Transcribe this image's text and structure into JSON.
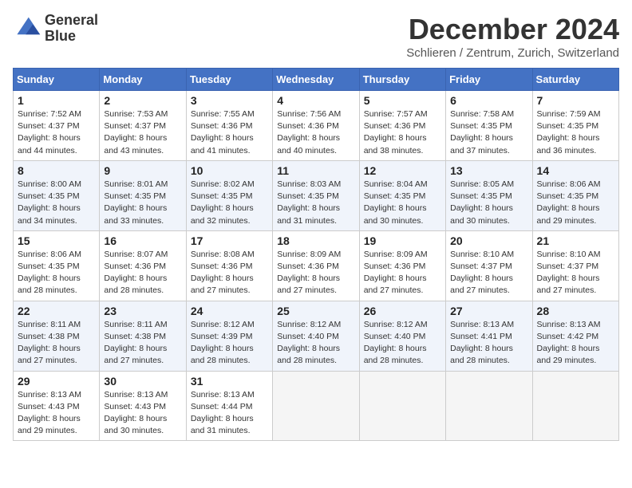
{
  "header": {
    "logo_line1": "General",
    "logo_line2": "Blue",
    "month_title": "December 2024",
    "subtitle": "Schlieren / Zentrum, Zurich, Switzerland"
  },
  "days_of_week": [
    "Sunday",
    "Monday",
    "Tuesday",
    "Wednesday",
    "Thursday",
    "Friday",
    "Saturday"
  ],
  "weeks": [
    [
      {
        "day": "1",
        "info": "Sunrise: 7:52 AM\nSunset: 4:37 PM\nDaylight: 8 hours\nand 44 minutes."
      },
      {
        "day": "2",
        "info": "Sunrise: 7:53 AM\nSunset: 4:37 PM\nDaylight: 8 hours\nand 43 minutes."
      },
      {
        "day": "3",
        "info": "Sunrise: 7:55 AM\nSunset: 4:36 PM\nDaylight: 8 hours\nand 41 minutes."
      },
      {
        "day": "4",
        "info": "Sunrise: 7:56 AM\nSunset: 4:36 PM\nDaylight: 8 hours\nand 40 minutes."
      },
      {
        "day": "5",
        "info": "Sunrise: 7:57 AM\nSunset: 4:36 PM\nDaylight: 8 hours\nand 38 minutes."
      },
      {
        "day": "6",
        "info": "Sunrise: 7:58 AM\nSunset: 4:35 PM\nDaylight: 8 hours\nand 37 minutes."
      },
      {
        "day": "7",
        "info": "Sunrise: 7:59 AM\nSunset: 4:35 PM\nDaylight: 8 hours\nand 36 minutes."
      }
    ],
    [
      {
        "day": "8",
        "info": "Sunrise: 8:00 AM\nSunset: 4:35 PM\nDaylight: 8 hours\nand 34 minutes."
      },
      {
        "day": "9",
        "info": "Sunrise: 8:01 AM\nSunset: 4:35 PM\nDaylight: 8 hours\nand 33 minutes."
      },
      {
        "day": "10",
        "info": "Sunrise: 8:02 AM\nSunset: 4:35 PM\nDaylight: 8 hours\nand 32 minutes."
      },
      {
        "day": "11",
        "info": "Sunrise: 8:03 AM\nSunset: 4:35 PM\nDaylight: 8 hours\nand 31 minutes."
      },
      {
        "day": "12",
        "info": "Sunrise: 8:04 AM\nSunset: 4:35 PM\nDaylight: 8 hours\nand 30 minutes."
      },
      {
        "day": "13",
        "info": "Sunrise: 8:05 AM\nSunset: 4:35 PM\nDaylight: 8 hours\nand 30 minutes."
      },
      {
        "day": "14",
        "info": "Sunrise: 8:06 AM\nSunset: 4:35 PM\nDaylight: 8 hours\nand 29 minutes."
      }
    ],
    [
      {
        "day": "15",
        "info": "Sunrise: 8:06 AM\nSunset: 4:35 PM\nDaylight: 8 hours\nand 28 minutes."
      },
      {
        "day": "16",
        "info": "Sunrise: 8:07 AM\nSunset: 4:36 PM\nDaylight: 8 hours\nand 28 minutes."
      },
      {
        "day": "17",
        "info": "Sunrise: 8:08 AM\nSunset: 4:36 PM\nDaylight: 8 hours\nand 27 minutes."
      },
      {
        "day": "18",
        "info": "Sunrise: 8:09 AM\nSunset: 4:36 PM\nDaylight: 8 hours\nand 27 minutes."
      },
      {
        "day": "19",
        "info": "Sunrise: 8:09 AM\nSunset: 4:36 PM\nDaylight: 8 hours\nand 27 minutes."
      },
      {
        "day": "20",
        "info": "Sunrise: 8:10 AM\nSunset: 4:37 PM\nDaylight: 8 hours\nand 27 minutes."
      },
      {
        "day": "21",
        "info": "Sunrise: 8:10 AM\nSunset: 4:37 PM\nDaylight: 8 hours\nand 27 minutes."
      }
    ],
    [
      {
        "day": "22",
        "info": "Sunrise: 8:11 AM\nSunset: 4:38 PM\nDaylight: 8 hours\nand 27 minutes."
      },
      {
        "day": "23",
        "info": "Sunrise: 8:11 AM\nSunset: 4:38 PM\nDaylight: 8 hours\nand 27 minutes."
      },
      {
        "day": "24",
        "info": "Sunrise: 8:12 AM\nSunset: 4:39 PM\nDaylight: 8 hours\nand 28 minutes."
      },
      {
        "day": "25",
        "info": "Sunrise: 8:12 AM\nSunset: 4:40 PM\nDaylight: 8 hours\nand 28 minutes."
      },
      {
        "day": "26",
        "info": "Sunrise: 8:12 AM\nSunset: 4:40 PM\nDaylight: 8 hours\nand 28 minutes."
      },
      {
        "day": "27",
        "info": "Sunrise: 8:13 AM\nSunset: 4:41 PM\nDaylight: 8 hours\nand 28 minutes."
      },
      {
        "day": "28",
        "info": "Sunrise: 8:13 AM\nSunset: 4:42 PM\nDaylight: 8 hours\nand 29 minutes."
      }
    ],
    [
      {
        "day": "29",
        "info": "Sunrise: 8:13 AM\nSunset: 4:43 PM\nDaylight: 8 hours\nand 29 minutes."
      },
      {
        "day": "30",
        "info": "Sunrise: 8:13 AM\nSunset: 4:43 PM\nDaylight: 8 hours\nand 30 minutes."
      },
      {
        "day": "31",
        "info": "Sunrise: 8:13 AM\nSunset: 4:44 PM\nDaylight: 8 hours\nand 31 minutes."
      },
      null,
      null,
      null,
      null
    ]
  ]
}
